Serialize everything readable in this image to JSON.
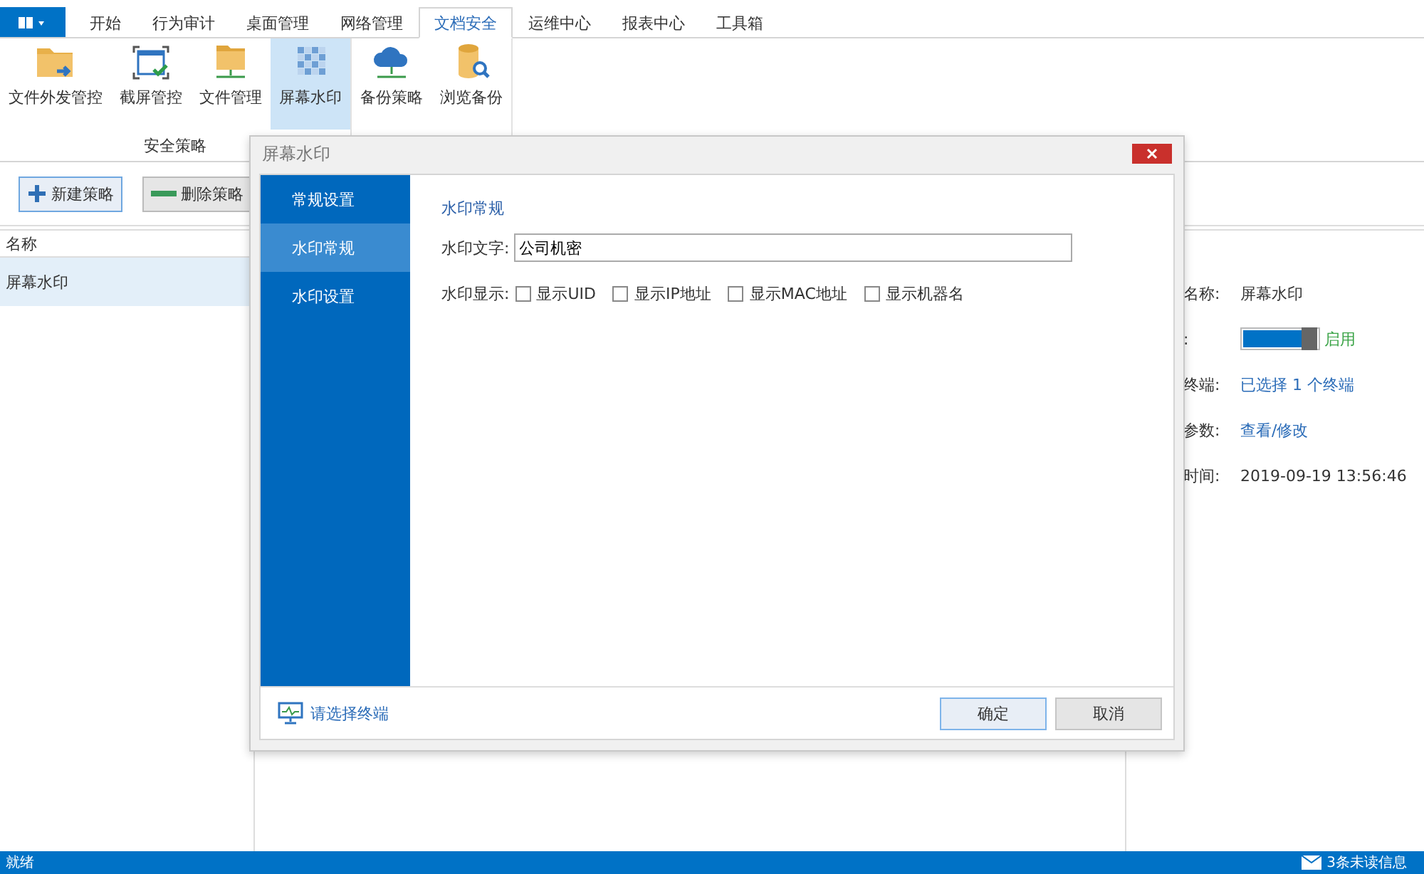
{
  "tabs": [
    {
      "label": "开始",
      "selected": false
    },
    {
      "label": "行为审计",
      "selected": false
    },
    {
      "label": "桌面管理",
      "selected": false
    },
    {
      "label": "网络管理",
      "selected": false
    },
    {
      "label": "文档安全",
      "selected": true
    },
    {
      "label": "运维中心",
      "selected": false
    },
    {
      "label": "报表中心",
      "selected": false
    },
    {
      "label": "工具箱",
      "selected": false
    }
  ],
  "ribbon": {
    "groups": [
      {
        "label": "安全策略",
        "items": [
          {
            "label": "文件外发管控",
            "selected": false
          },
          {
            "label": "截屏管控",
            "selected": false
          },
          {
            "label": "文件管理",
            "selected": false
          },
          {
            "label": "屏幕水印",
            "selected": true
          }
        ]
      },
      {
        "items": [
          {
            "label": "备份策略",
            "selected": false
          },
          {
            "label": "浏览备份",
            "selected": false
          }
        ]
      }
    ]
  },
  "toolbar": [
    {
      "label": "新建策略",
      "kind": "add",
      "focused": true
    },
    {
      "label": "删除策略",
      "kind": "remove",
      "focused": false
    }
  ],
  "policy_list": {
    "columns": [
      "名称"
    ],
    "rows": [
      {
        "name": "屏幕水印",
        "selected": true
      }
    ]
  },
  "details": [
    {
      "label": "名称:",
      "kind": "text",
      "value": "屏幕水印"
    },
    {
      "label": ":",
      "kind": "switch",
      "on": true,
      "value": "启用"
    },
    {
      "label": "终端:",
      "kind": "link",
      "value": "已选择 1 个终端"
    },
    {
      "label": "参数:",
      "kind": "link",
      "value": "查看/修改"
    },
    {
      "label": "时间:",
      "kind": "text",
      "value": "2019-09-19 13:56:46"
    }
  ],
  "dialog": {
    "title": "屏幕水印",
    "nav": [
      {
        "label": "常规设置",
        "selected": false
      },
      {
        "label": "水印常规",
        "selected": true
      },
      {
        "label": "水印设置",
        "selected": false
      }
    ],
    "section_title": "水印常规",
    "text_field": {
      "label": "水印文字:",
      "value": "公司机密"
    },
    "display": {
      "label": "水印显示:",
      "options": [
        {
          "label": "显示UID",
          "checked": false
        },
        {
          "label": "显示IP地址",
          "checked": false
        },
        {
          "label": "显示MAC地址",
          "checked": false
        },
        {
          "label": "显示机器名",
          "checked": false
        }
      ]
    },
    "footer_link": "请选择终端",
    "buttons": [
      {
        "label": "确定",
        "kind": "primary"
      },
      {
        "label": "取消",
        "kind": "secondary"
      }
    ]
  },
  "status_bar": {
    "text": "就绪",
    "messages": "3条未读信息"
  }
}
